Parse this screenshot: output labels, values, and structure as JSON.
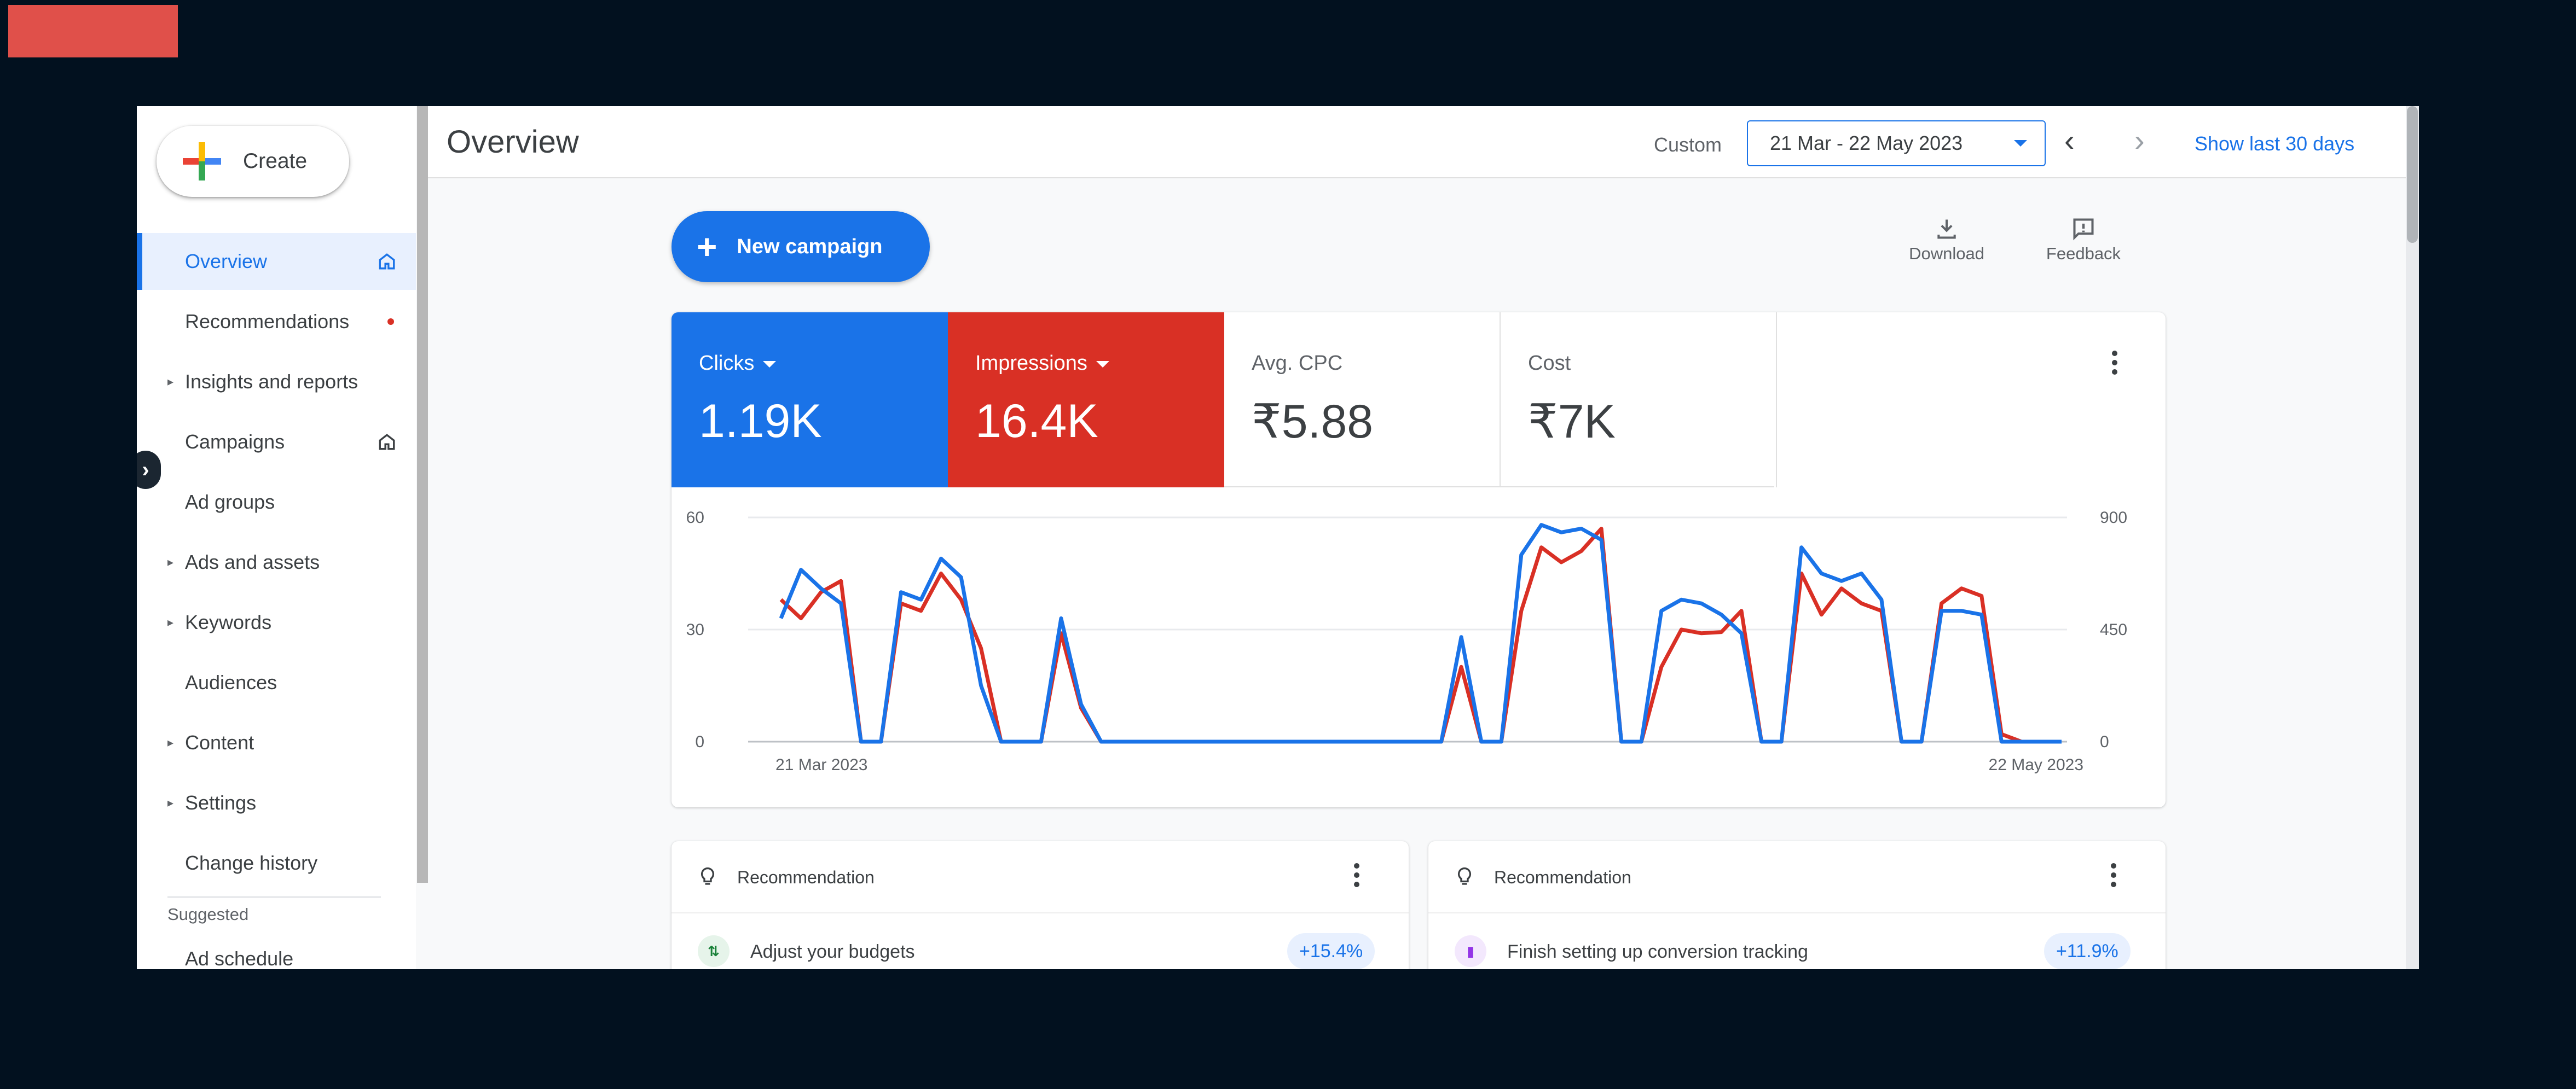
{
  "colors": {
    "accent": "#1a73e8",
    "impressions": "#d93025",
    "background": "#02111f"
  },
  "sidebar": {
    "create_label": "Create",
    "items": [
      {
        "label": "Overview",
        "active": true,
        "icon": "home-icon"
      },
      {
        "label": "Recommendations",
        "badge": "red-dot"
      },
      {
        "label": "Insights and reports",
        "expandable": true
      },
      {
        "label": "Campaigns",
        "icon": "home-icon"
      },
      {
        "label": "Ad groups"
      },
      {
        "label": "Ads and assets",
        "expandable": true
      },
      {
        "label": "Keywords",
        "expandable": true
      },
      {
        "label": "Audiences"
      },
      {
        "label": "Content",
        "expandable": true
      },
      {
        "label": "Settings",
        "expandable": true
      },
      {
        "label": "Change history"
      }
    ],
    "suggested_label": "Suggested",
    "suggested_items": [
      {
        "label": "Ad schedule"
      }
    ]
  },
  "header": {
    "title": "Overview",
    "custom_label": "Custom",
    "date_range": "21 Mar - 22 May 2023",
    "show_last": "Show last 30 days"
  },
  "main": {
    "new_campaign_label": "New campaign",
    "download_label": "Download",
    "feedback_label": "Feedback"
  },
  "metrics": [
    {
      "name": "Clicks",
      "value": "1.19K",
      "dropdown": true
    },
    {
      "name": "Impressions",
      "value": "16.4K",
      "dropdown": true
    },
    {
      "name": "Avg. CPC",
      "value": "₹5.88"
    },
    {
      "name": "Cost",
      "value": "₹7K"
    }
  ],
  "chart_data": {
    "type": "line",
    "x_labels": [
      "21 Mar 2023",
      "22 May 2023"
    ],
    "y_left_ticks": [
      "60",
      "30",
      "0"
    ],
    "y_right_ticks": [
      "900",
      "450",
      "0"
    ],
    "y_left_range": [
      0,
      60
    ],
    "y_right_range": [
      0,
      900
    ],
    "grid": true,
    "series": [
      {
        "name": "Clicks",
        "color": "#1a73e8",
        "axis": "left",
        "values": [
          33,
          46,
          41,
          37,
          0,
          0,
          40,
          38,
          49,
          44,
          15,
          0,
          0,
          0,
          33,
          10,
          0,
          0,
          0,
          0,
          0,
          0,
          0,
          0,
          0,
          0,
          0,
          0,
          0,
          0,
          0,
          0,
          0,
          0,
          28,
          0,
          0,
          50,
          58,
          56,
          57,
          54,
          0,
          0,
          35,
          38,
          37,
          34,
          29,
          0,
          0,
          52,
          45,
          43,
          45,
          38,
          0,
          0,
          35,
          35,
          34,
          0,
          0,
          0,
          0
        ]
      },
      {
        "name": "Impressions",
        "color": "#d93025",
        "axis": "right",
        "values": [
          570,
          495,
          600,
          645,
          0,
          0,
          555,
          525,
          675,
          570,
          375,
          0,
          0,
          0,
          435,
          135,
          0,
          0,
          0,
          0,
          0,
          0,
          0,
          0,
          0,
          0,
          0,
          0,
          0,
          0,
          0,
          0,
          0,
          0,
          300,
          0,
          0,
          525,
          780,
          720,
          765,
          855,
          0,
          0,
          300,
          450,
          435,
          440,
          525,
          0,
          0,
          675,
          510,
          615,
          555,
          525,
          0,
          0,
          555,
          615,
          585,
          30,
          0,
          0,
          0
        ]
      }
    ]
  },
  "recommendations": [
    {
      "header": "Recommendation",
      "text": "Adjust your budgets",
      "badge": "+15.4%",
      "icon": "budget-icon"
    },
    {
      "header": "Recommendation",
      "text": "Finish setting up conversion tracking",
      "badge": "+11.9%",
      "icon": "bar-chart-icon"
    }
  ]
}
